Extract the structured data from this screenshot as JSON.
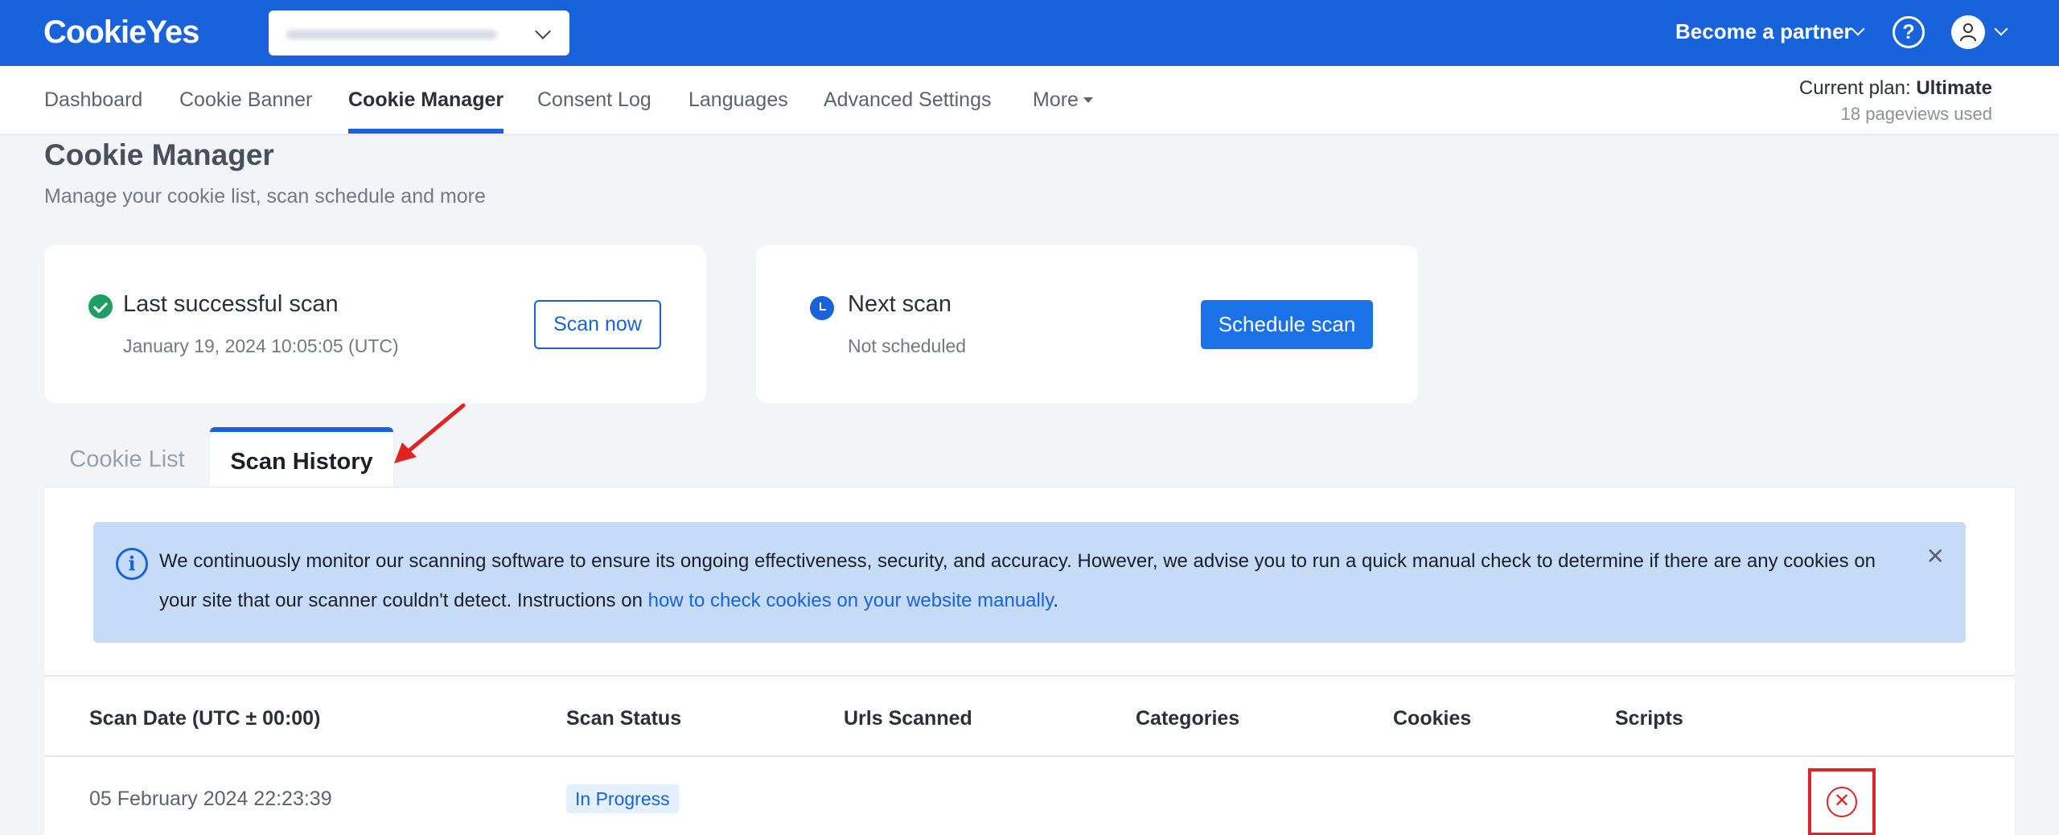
{
  "header": {
    "logo": "CookieYes",
    "partner_label": "Become a partner",
    "help_icon": "help-icon",
    "help_glyph": "?"
  },
  "nav": {
    "items": [
      "Dashboard",
      "Cookie Banner",
      "Cookie Manager",
      "Consent Log",
      "Languages",
      "Advanced Settings",
      "More"
    ],
    "active": "Cookie Manager",
    "plan_label": "Current plan:",
    "plan_value": "Ultimate",
    "pageviews": "18 pageviews used"
  },
  "page": {
    "title": "Cookie Manager",
    "subtitle": "Manage your cookie list, scan schedule and more"
  },
  "cards": {
    "last_scan": {
      "title": "Last successful scan",
      "date": "January 19, 2024 10:05:05 (UTC)",
      "button": "Scan now"
    },
    "next_scan": {
      "title": "Next scan",
      "status": "Not scheduled",
      "button": "Schedule scan"
    }
  },
  "tabs": [
    "Cookie List",
    "Scan History"
  ],
  "alert": {
    "text_1": "We continuously monitor our scanning software to ensure its ongoing effectiveness, security, and accuracy. However, we advise you to run a quick manual check to determine if there are any cookies on your site that our scanner couldn't detect. Instructions on ",
    "link": "how to check cookies on your website manually",
    "text_2": ".",
    "close_glyph": "✕"
  },
  "table": {
    "columns": [
      "Scan Date (UTC ± 00:00)",
      "Scan Status",
      "Urls Scanned",
      "Categories",
      "Cookies",
      "Scripts"
    ],
    "rows": [
      {
        "date": "05 February 2024 22:23:39",
        "status": "In Progress",
        "action_glyph": "✕"
      }
    ]
  },
  "colors": {
    "brand": "#1863dc",
    "success": "#1e9e62",
    "alert_bg": "#c5dbf7",
    "highlight": "#e02424"
  }
}
